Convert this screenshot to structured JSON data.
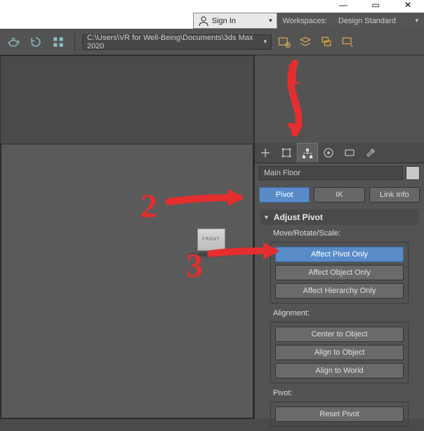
{
  "window_controls": {
    "min": "—",
    "max": "▭",
    "close": "✕"
  },
  "signin": {
    "label": "Sign In"
  },
  "workspaces": {
    "heading": "Workspaces:",
    "selected": "Design Standard"
  },
  "path": "C:\\Users\\VR for Well-Being\\Documents\\3ds Max 2020",
  "viewcube": {
    "face": "FRONT"
  },
  "object_name": "Main Floor",
  "mode_tabs": {
    "pivot": "Pivot",
    "ik": "IK",
    "link": "Link Info"
  },
  "rollout": {
    "title": "Adjust Pivot"
  },
  "move_rotate_scale": {
    "label": "Move/Rotate/Scale:",
    "affect_pivot": "Affect Pivot Only",
    "affect_object": "Affect Object Only",
    "affect_hierarchy": "Affect Hierarchy Only"
  },
  "alignment": {
    "label": "Alignment:",
    "center": "Center to Object",
    "align_obj": "Align to Object",
    "align_world": "Align to World"
  },
  "pivot_section": {
    "label": "Pivot:",
    "reset": "Reset Pivot"
  },
  "annotations": {
    "n1": "1",
    "n2": "2",
    "n3": "3"
  }
}
